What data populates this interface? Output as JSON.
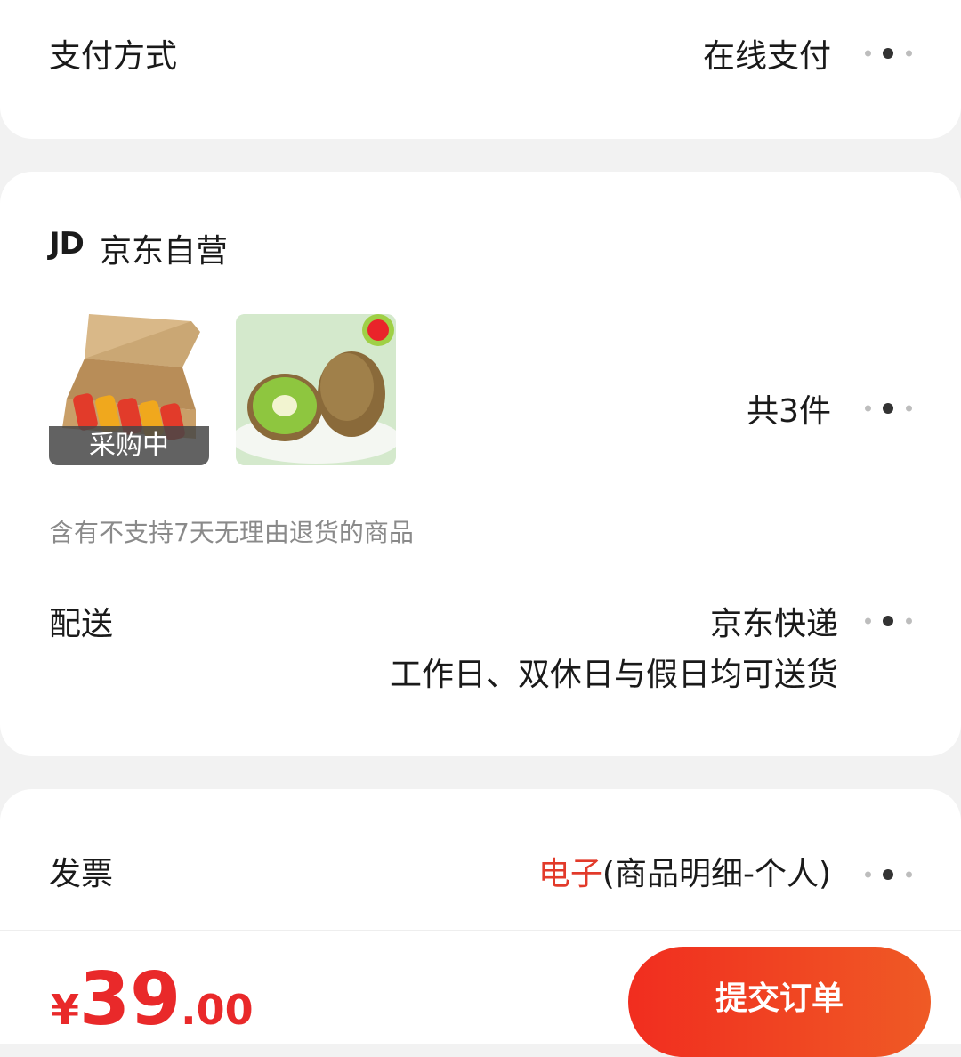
{
  "payment": {
    "label": "支付方式",
    "value": "在线支付"
  },
  "shop": {
    "logo": "JD",
    "name": "京东自营",
    "products": [
      {
        "badge": "采购中"
      },
      {
        "badge": ""
      }
    ],
    "count": "共3件",
    "notice": "含有不支持7天无理由退货的商品",
    "delivery": {
      "label": "配送",
      "carrier": "京东快递",
      "schedule": "工作日、双休日与假日均可送货"
    }
  },
  "invoice": {
    "label": "发票",
    "type": "电子",
    "detail": "(商品明细-个人)"
  },
  "footer": {
    "currency": "¥",
    "price_int": "39",
    "price_dec": ".00",
    "submit": "提交订单"
  },
  "colors": {
    "accent": "#e23a2a",
    "button_start": "#f12d1f",
    "button_end": "#ef5a25"
  },
  "icons": [
    "more-dots-icon",
    "jd-logo"
  ]
}
